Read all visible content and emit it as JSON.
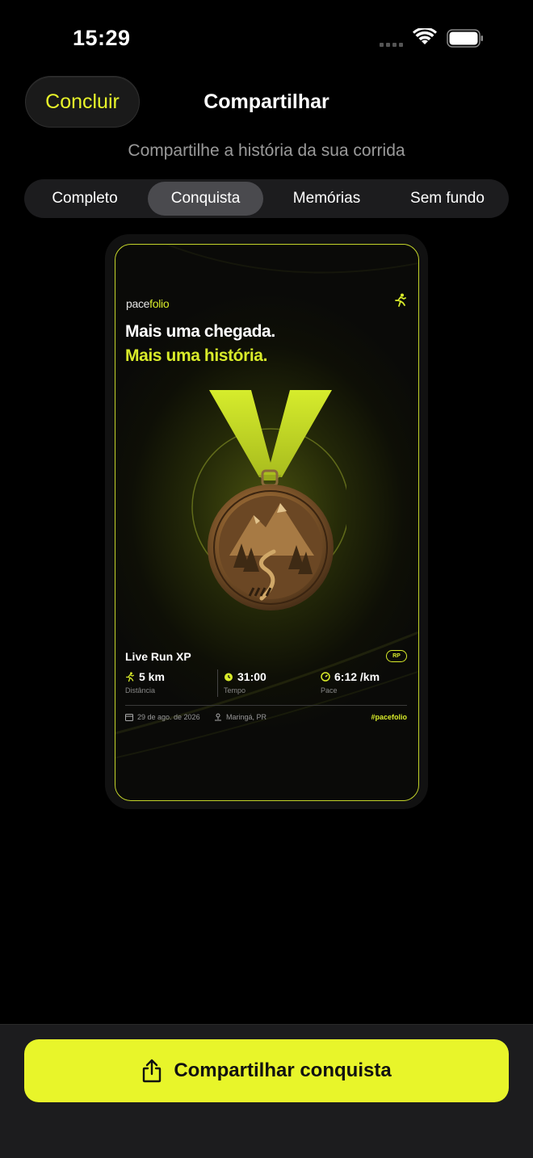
{
  "status": {
    "time": "15:29"
  },
  "header": {
    "done_label": "Concluir",
    "title": "Compartilhar",
    "subtitle": "Compartilhe a história da sua corrida"
  },
  "tabs": [
    {
      "label": "Completo",
      "selected": false
    },
    {
      "label": "Conquista",
      "selected": true
    },
    {
      "label": "Memórias",
      "selected": false
    },
    {
      "label": "Sem fundo",
      "selected": false
    }
  ],
  "card": {
    "brand_prefix": "pace",
    "brand_suffix": "folio",
    "headline_line1": "Mais uma chegada.",
    "headline_line2": "Mais uma história.",
    "race_name": "Live Run XP",
    "race_badge": "RP",
    "stats": [
      {
        "value": "5 km",
        "label": "Distância",
        "icon": "runner-icon"
      },
      {
        "value": "31:00",
        "label": "Tempo",
        "icon": "stopwatch-icon"
      },
      {
        "value": "6:12 /km",
        "label": "Pace",
        "icon": "gauge-icon"
      }
    ],
    "date": "29 de ago. de 2026",
    "location": "Maringá, PR",
    "hashtag": "#pacefolio"
  },
  "actions": {
    "share_label": "Compartilhar conquista"
  },
  "colors": {
    "accent": "#e8f52a",
    "background": "#000000",
    "panel": "#1c1c1e"
  }
}
